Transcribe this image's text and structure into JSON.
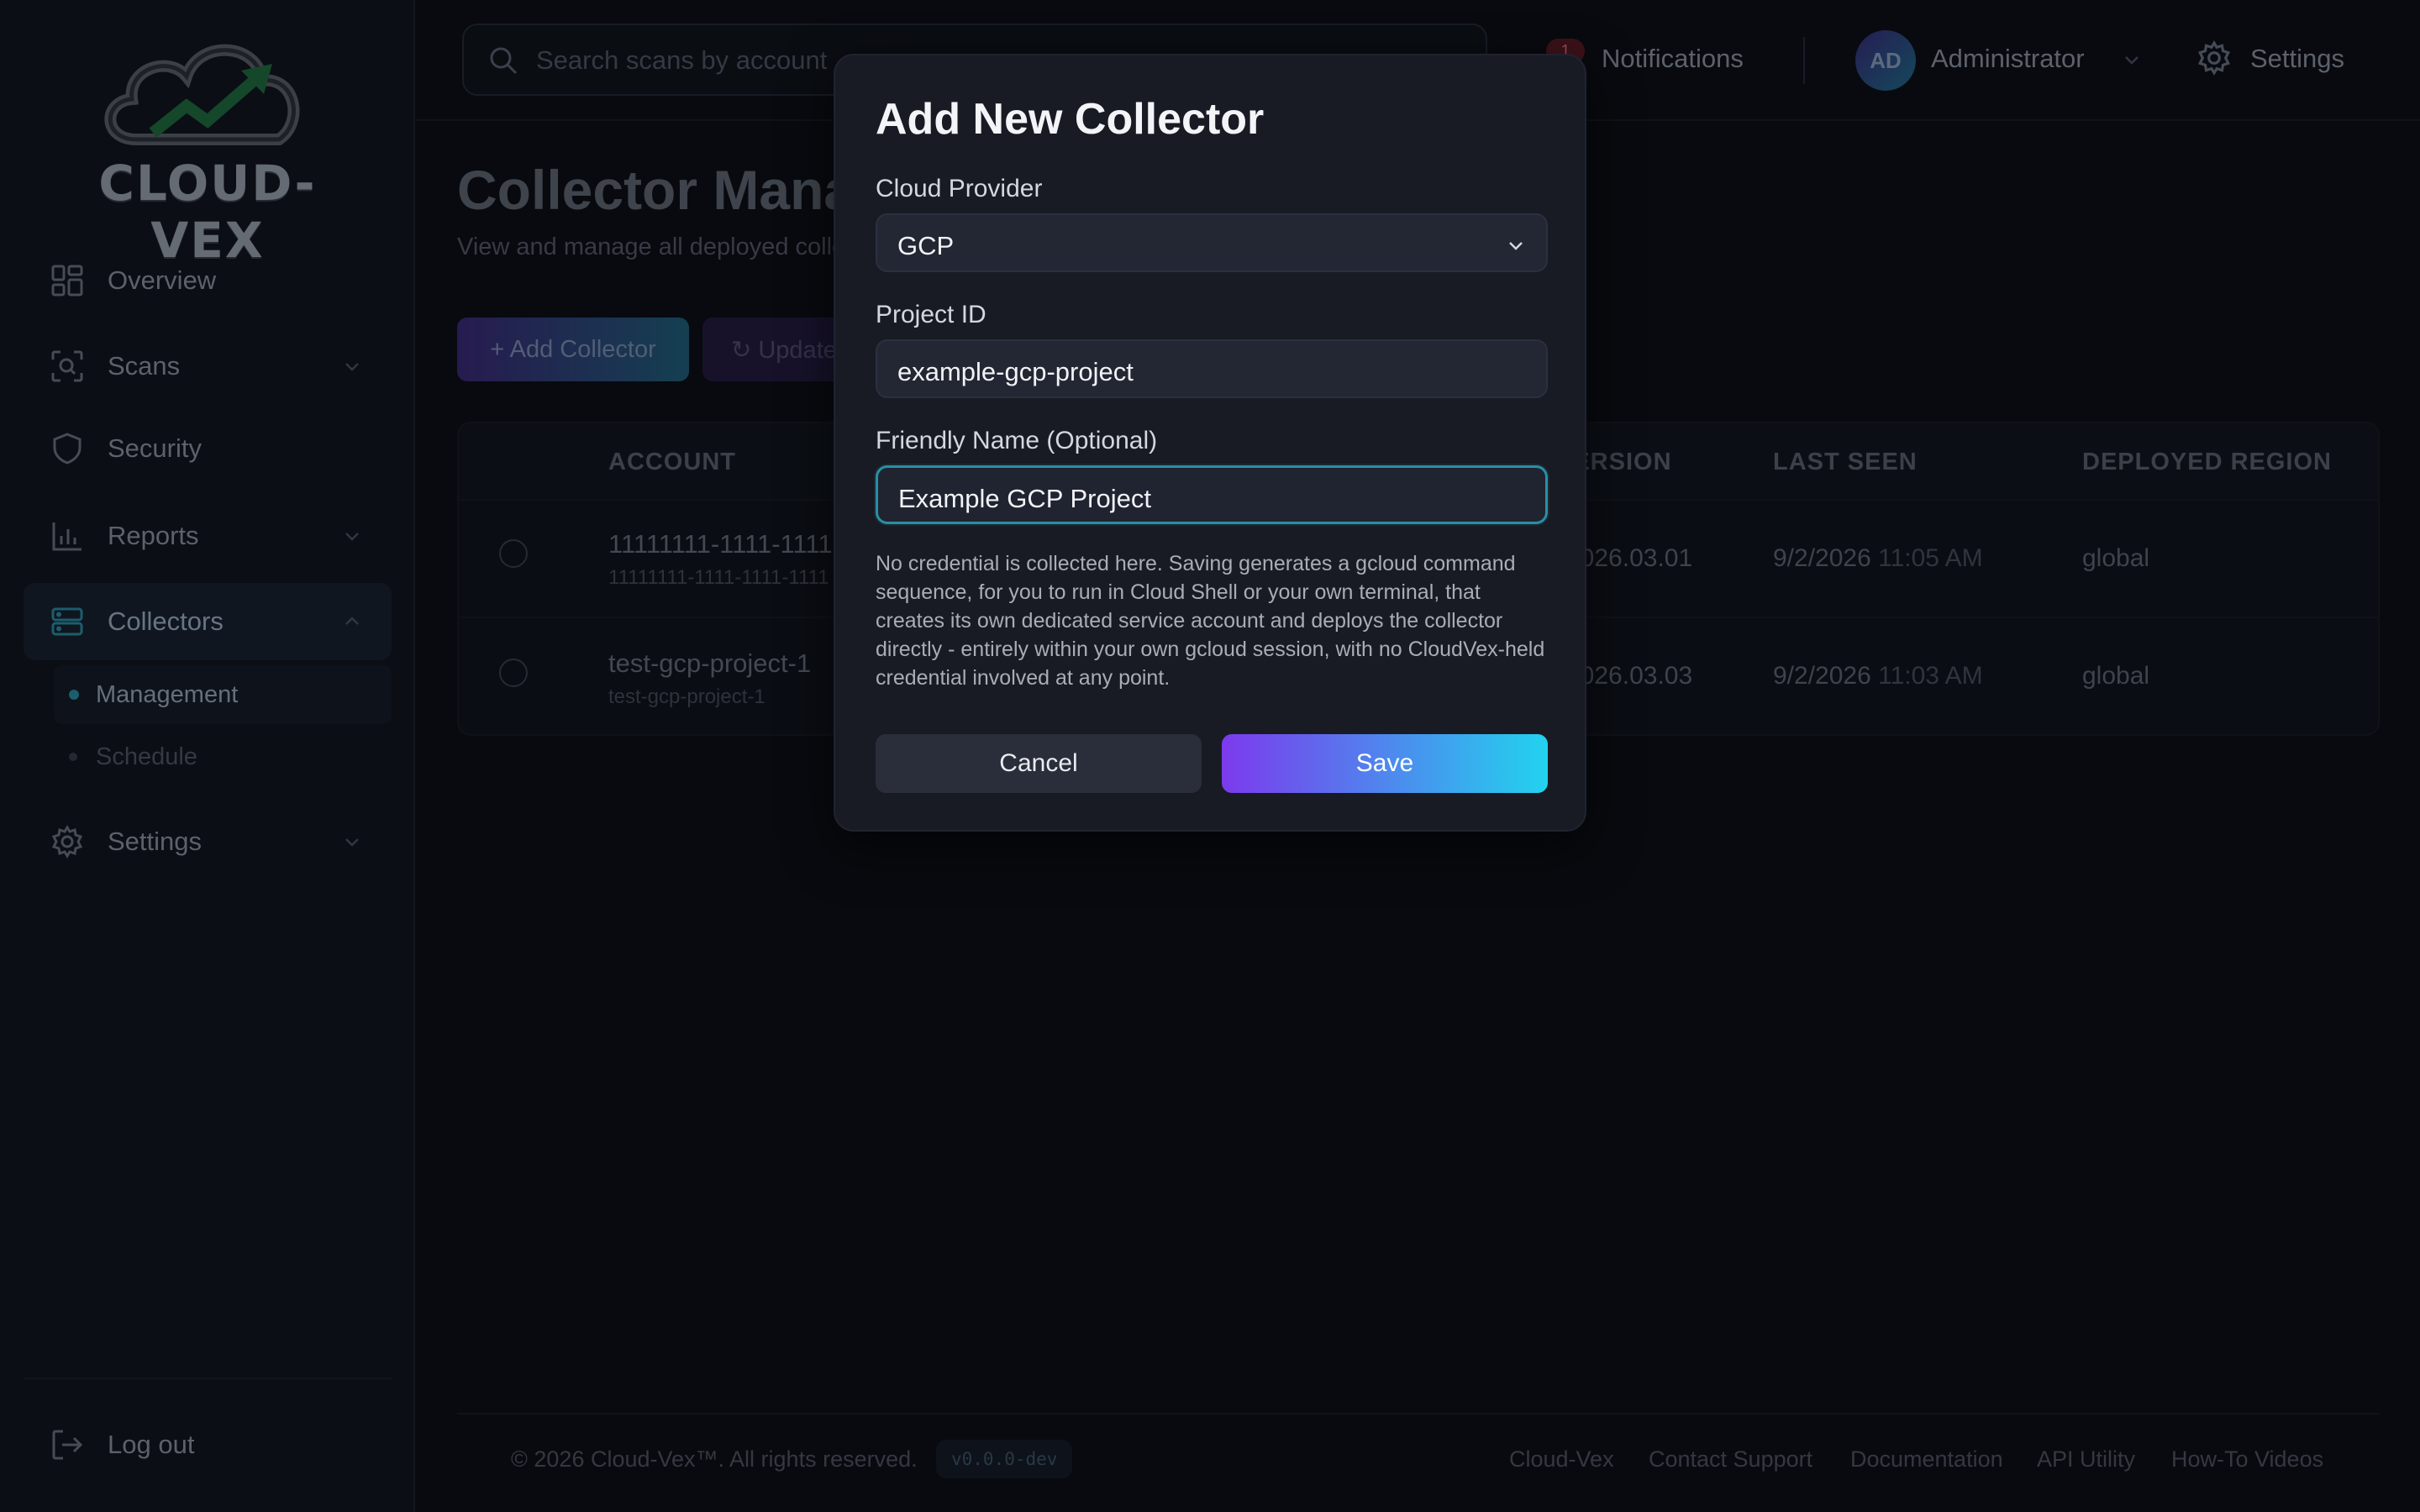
{
  "brand": {
    "name": "CLOUD-VEX"
  },
  "sidebar": {
    "items": [
      {
        "label": "Overview",
        "icon": "dashboard-icon"
      },
      {
        "label": "Scans",
        "icon": "scan-icon"
      },
      {
        "label": "Security",
        "icon": "shield-icon"
      },
      {
        "label": "Reports",
        "icon": "bar-chart-icon"
      },
      {
        "label": "Collectors",
        "icon": "server-icon"
      },
      {
        "label": "Settings",
        "icon": "gear-icon"
      }
    ],
    "subitems": [
      {
        "label": "Management",
        "active": true
      },
      {
        "label": "Schedule",
        "active": false
      }
    ],
    "logout": "Log out"
  },
  "header": {
    "search_placeholder": "Search scans by account",
    "notifications_count": "1",
    "notifications_label": "Notifications",
    "avatar_initials": "AD",
    "user_name": "Administrator",
    "settings_label": "Settings"
  },
  "main": {
    "title": "Collector Management",
    "subtitle": "View and manage all deployed collectors",
    "add_button": "+ Add Collector",
    "update_button": "Update"
  },
  "table": {
    "headers": [
      "ACCOUNT",
      "VERSION",
      "LAST SEEN",
      "DEPLOYED REGION"
    ],
    "rows": [
      {
        "account": "11111111-1111-1111-1111",
        "account_sub": "11111111-1111-1111-1111",
        "version": "2026.03.01",
        "last_seen_date": "9/2/2026",
        "last_seen_time": "11:05 AM",
        "region": "global"
      },
      {
        "account": "test-gcp-project-1",
        "account_sub": "test-gcp-project-1",
        "version": "2026.03.03",
        "last_seen_date": "9/2/2026",
        "last_seen_time": "11:03 AM",
        "region": "global"
      }
    ]
  },
  "footer": {
    "copyright": "© 2026 Cloud-Vex™. All rights reserved.",
    "version": "v0.0.0-dev",
    "links": [
      "Cloud-Vex",
      "Contact Support",
      "Documentation",
      "API Utility",
      "How-To Videos"
    ]
  },
  "modal": {
    "title": "Add New Collector",
    "provider_label": "Cloud Provider",
    "provider_value": "GCP",
    "project_label": "Project ID",
    "project_value": "example-gcp-project",
    "name_label": "Friendly Name (Optional)",
    "name_value": "Example GCP Project",
    "help_text": "No credential is collected here. Saving generates a gcloud command sequence, for you to run in Cloud Shell or your own terminal, that creates its own dedicated service account and deploys the collector directly - entirely within your own gcloud session, with no CloudVex-held credential involved at any point.",
    "cancel_label": "Cancel",
    "save_label": "Save"
  },
  "colors": {
    "accent_purple": "#7c3aed",
    "accent_cyan": "#22d3ee",
    "focus_ring": "#2a8fa3",
    "background": "#0b0d13"
  }
}
